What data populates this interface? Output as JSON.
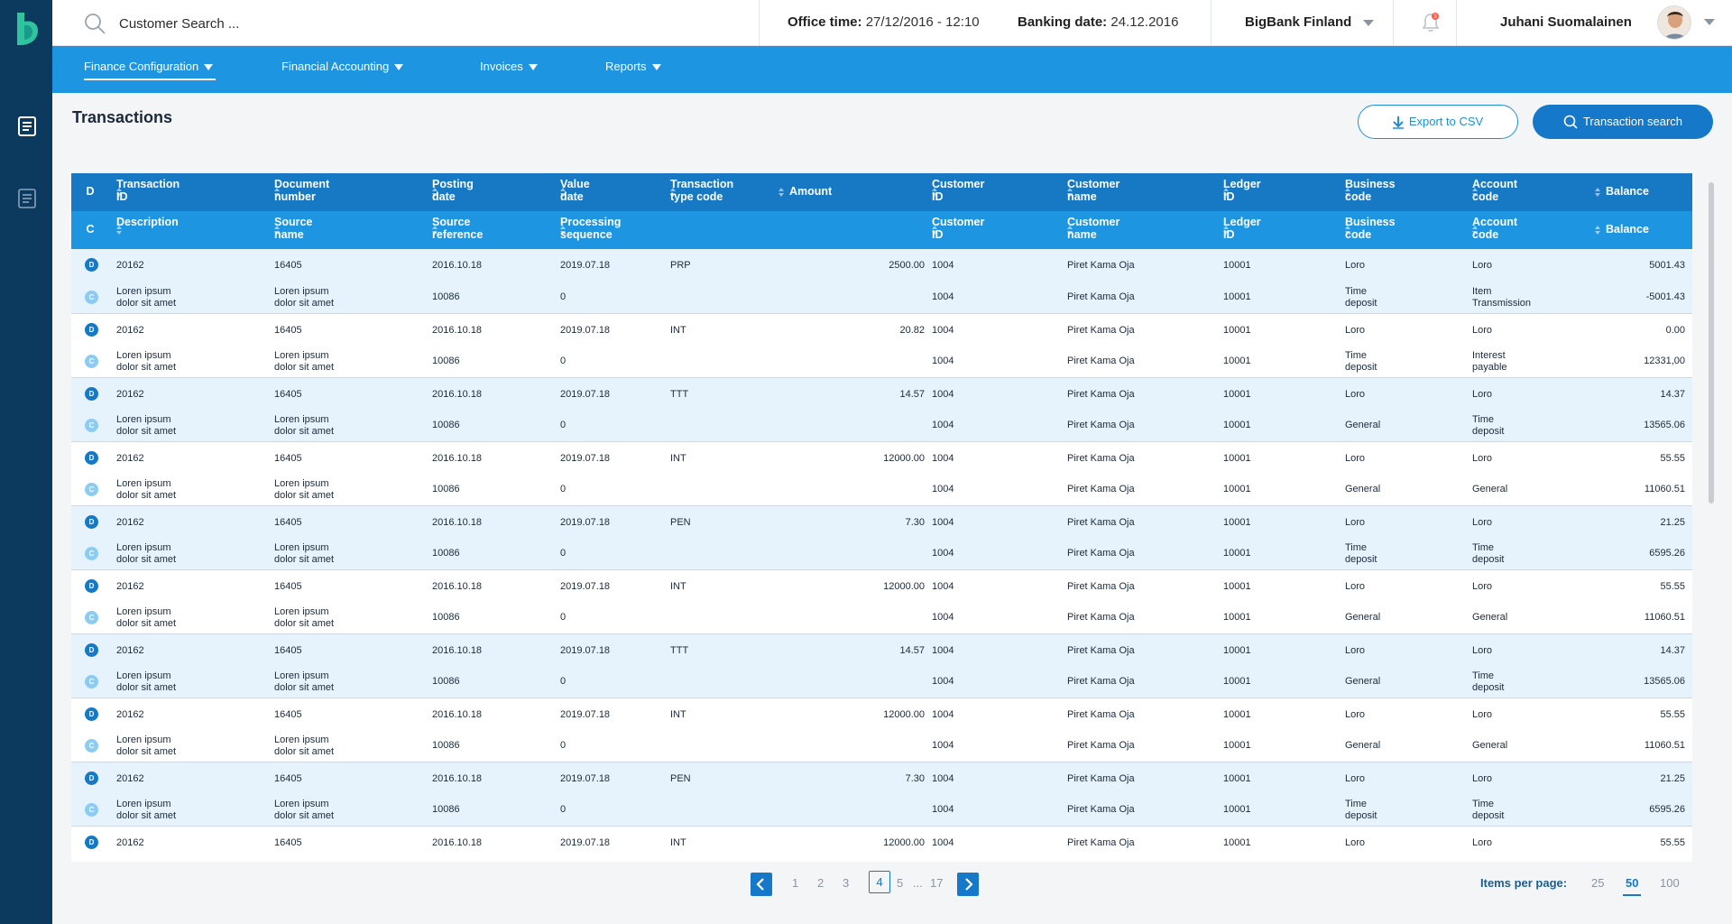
{
  "search": {
    "placeholder": "Customer Search ..."
  },
  "office_time": {
    "label": "Office time:",
    "value": "27/12/2016 - 12:10"
  },
  "banking_date": {
    "label": "Banking date:",
    "value": "24.12.2016"
  },
  "bank": {
    "name": "BigBank Finland"
  },
  "notifications": {
    "count": "3"
  },
  "user": {
    "name": "Juhani Suomalainen"
  },
  "nav": {
    "items": [
      {
        "label": "Finance Configuration"
      },
      {
        "label": "Financial Accounting"
      },
      {
        "label": "Invoices"
      },
      {
        "label": "Reports"
      }
    ]
  },
  "page": {
    "title": "Transactions",
    "export_label": "Export to CSV",
    "search_label": "Transaction search"
  },
  "table": {
    "header1": [
      "D",
      "Transaction\nID",
      "Document\nnumber",
      "Posting\ndate",
      "Value\ndate",
      "Transaction\ntype code",
      "Amount",
      "Customer\nID",
      "Customer\nname",
      "Ledger\nID",
      "Business\ncode",
      "Account\ncode",
      "Balance"
    ],
    "header2": [
      "C",
      "Description",
      "Source\nname",
      "Source\nreference",
      "Processing\nsequence",
      "",
      "",
      "Customer\nID",
      "Customer\nname",
      "Ledger\nID",
      "Business\ncode",
      "Account\ncode",
      "Balance"
    ],
    "groups": [
      {
        "d": [
          "D",
          "20162",
          "16405",
          "2016.10.18",
          "2019.07.18",
          "PRP",
          "2500.00",
          "1004",
          "Piret Kama Oja",
          "10001",
          "Loro",
          "Loro",
          "5001.43"
        ],
        "c": [
          "C",
          "Loren ipsum\ndolor sit amet",
          "Loren ipsum\ndolor sit amet",
          "10086",
          "0",
          "",
          "",
          "1004",
          "Piret Kama Oja",
          "10001",
          "Time\ndeposit",
          "Item\nTransmission",
          "-5001.43"
        ]
      },
      {
        "d": [
          "D",
          "20162",
          "16405",
          "2016.10.18",
          "2019.07.18",
          "INT",
          "20.82",
          "1004",
          "Piret Kama Oja",
          "10001",
          "Loro",
          "Loro",
          "0.00"
        ],
        "c": [
          "C",
          "Loren ipsum\ndolor sit amet",
          "Loren ipsum\ndolor sit amet",
          "10086",
          "0",
          "",
          "",
          "1004",
          "Piret Kama Oja",
          "10001",
          "Time\ndeposit",
          "Interest\npayable",
          "12331,00"
        ]
      },
      {
        "d": [
          "D",
          "20162",
          "16405",
          "2016.10.18",
          "2019.07.18",
          "TTT",
          "14.57",
          "1004",
          "Piret Kama Oja",
          "10001",
          "Loro",
          "Loro",
          "14.37"
        ],
        "c": [
          "C",
          "Loren ipsum\ndolor sit amet",
          "Loren ipsum\ndolor sit amet",
          "10086",
          "0",
          "",
          "",
          "1004",
          "Piret Kama Oja",
          "10001",
          "General",
          "Time\ndeposit",
          "13565.06"
        ]
      },
      {
        "d": [
          "D",
          "20162",
          "16405",
          "2016.10.18",
          "2019.07.18",
          "INT",
          "12000.00",
          "1004",
          "Piret Kama Oja",
          "10001",
          "Loro",
          "Loro",
          "55.55"
        ],
        "c": [
          "C",
          "Loren ipsum\ndolor sit amet",
          "Loren ipsum\ndolor sit amet",
          "10086",
          "0",
          "",
          "",
          "1004",
          "Piret Kama Oja",
          "10001",
          "General",
          "General",
          "11060.51"
        ]
      },
      {
        "d": [
          "D",
          "20162",
          "16405",
          "2016.10.18",
          "2019.07.18",
          "PEN",
          "7.30",
          "1004",
          "Piret Kama Oja",
          "10001",
          "Loro",
          "Loro",
          "21.25"
        ],
        "c": [
          "C",
          "Loren ipsum\ndolor sit amet",
          "Loren ipsum\ndolor sit amet",
          "10086",
          "0",
          "",
          "",
          "1004",
          "Piret Kama Oja",
          "10001",
          "Time\ndeposit",
          "Time\ndeposit",
          "6595.26"
        ]
      },
      {
        "d": [
          "D",
          "20162",
          "16405",
          "2016.10.18",
          "2019.07.18",
          "INT",
          "12000.00",
          "1004",
          "Piret Kama Oja",
          "10001",
          "Loro",
          "Loro",
          "55.55"
        ],
        "c": [
          "C",
          "Loren ipsum\ndolor sit amet",
          "Loren ipsum\ndolor sit amet",
          "10086",
          "0",
          "",
          "",
          "1004",
          "Piret Kama Oja",
          "10001",
          "General",
          "General",
          "11060.51"
        ]
      },
      {
        "d": [
          "D",
          "20162",
          "16405",
          "2016.10.18",
          "2019.07.18",
          "TTT",
          "14.57",
          "1004",
          "Piret Kama Oja",
          "10001",
          "Loro",
          "Loro",
          "14.37"
        ],
        "c": [
          "C",
          "Loren ipsum\ndolor sit amet",
          "Loren ipsum\ndolor sit amet",
          "10086",
          "0",
          "",
          "",
          "1004",
          "Piret Kama Oja",
          "10001",
          "General",
          "Time\ndeposit",
          "13565.06"
        ]
      },
      {
        "d": [
          "D",
          "20162",
          "16405",
          "2016.10.18",
          "2019.07.18",
          "INT",
          "12000.00",
          "1004",
          "Piret Kama Oja",
          "10001",
          "Loro",
          "Loro",
          "55.55"
        ],
        "c": [
          "C",
          "Loren ipsum\ndolor sit amet",
          "Loren ipsum\ndolor sit amet",
          "10086",
          "0",
          "",
          "",
          "1004",
          "Piret Kama Oja",
          "10001",
          "General",
          "General",
          "11060.51"
        ]
      },
      {
        "d": [
          "D",
          "20162",
          "16405",
          "2016.10.18",
          "2019.07.18",
          "PEN",
          "7.30",
          "1004",
          "Piret Kama Oja",
          "10001",
          "Loro",
          "Loro",
          "21.25"
        ],
        "c": [
          "C",
          "Loren ipsum\ndolor sit amet",
          "Loren ipsum\ndolor sit amet",
          "10086",
          "0",
          "",
          "",
          "1004",
          "Piret Kama Oja",
          "10001",
          "Time\ndeposit",
          "Time\ndeposit",
          "6595.26"
        ]
      },
      {
        "d": [
          "D",
          "20162",
          "16405",
          "2016.10.18",
          "2019.07.18",
          "INT",
          "12000.00",
          "1004",
          "Piret Kama Oja",
          "10001",
          "Loro",
          "Loro",
          "55.55"
        ]
      }
    ]
  },
  "pagination": {
    "pages": [
      "1",
      "2",
      "3",
      "4",
      "5",
      "...",
      "17"
    ],
    "current": "4"
  },
  "items_per_page": {
    "label": "Items per page:",
    "options": [
      "25",
      "50",
      "100"
    ],
    "selected": "50"
  },
  "colors": {
    "rail": "#0c3a5e",
    "nav": "#1e95e0",
    "header_primary": "#1778c4",
    "header_secondary": "#1e95e0",
    "accent": "#1678c8",
    "row_alt": "#e6f3fc",
    "credit_badge": "#8ccbf2"
  }
}
